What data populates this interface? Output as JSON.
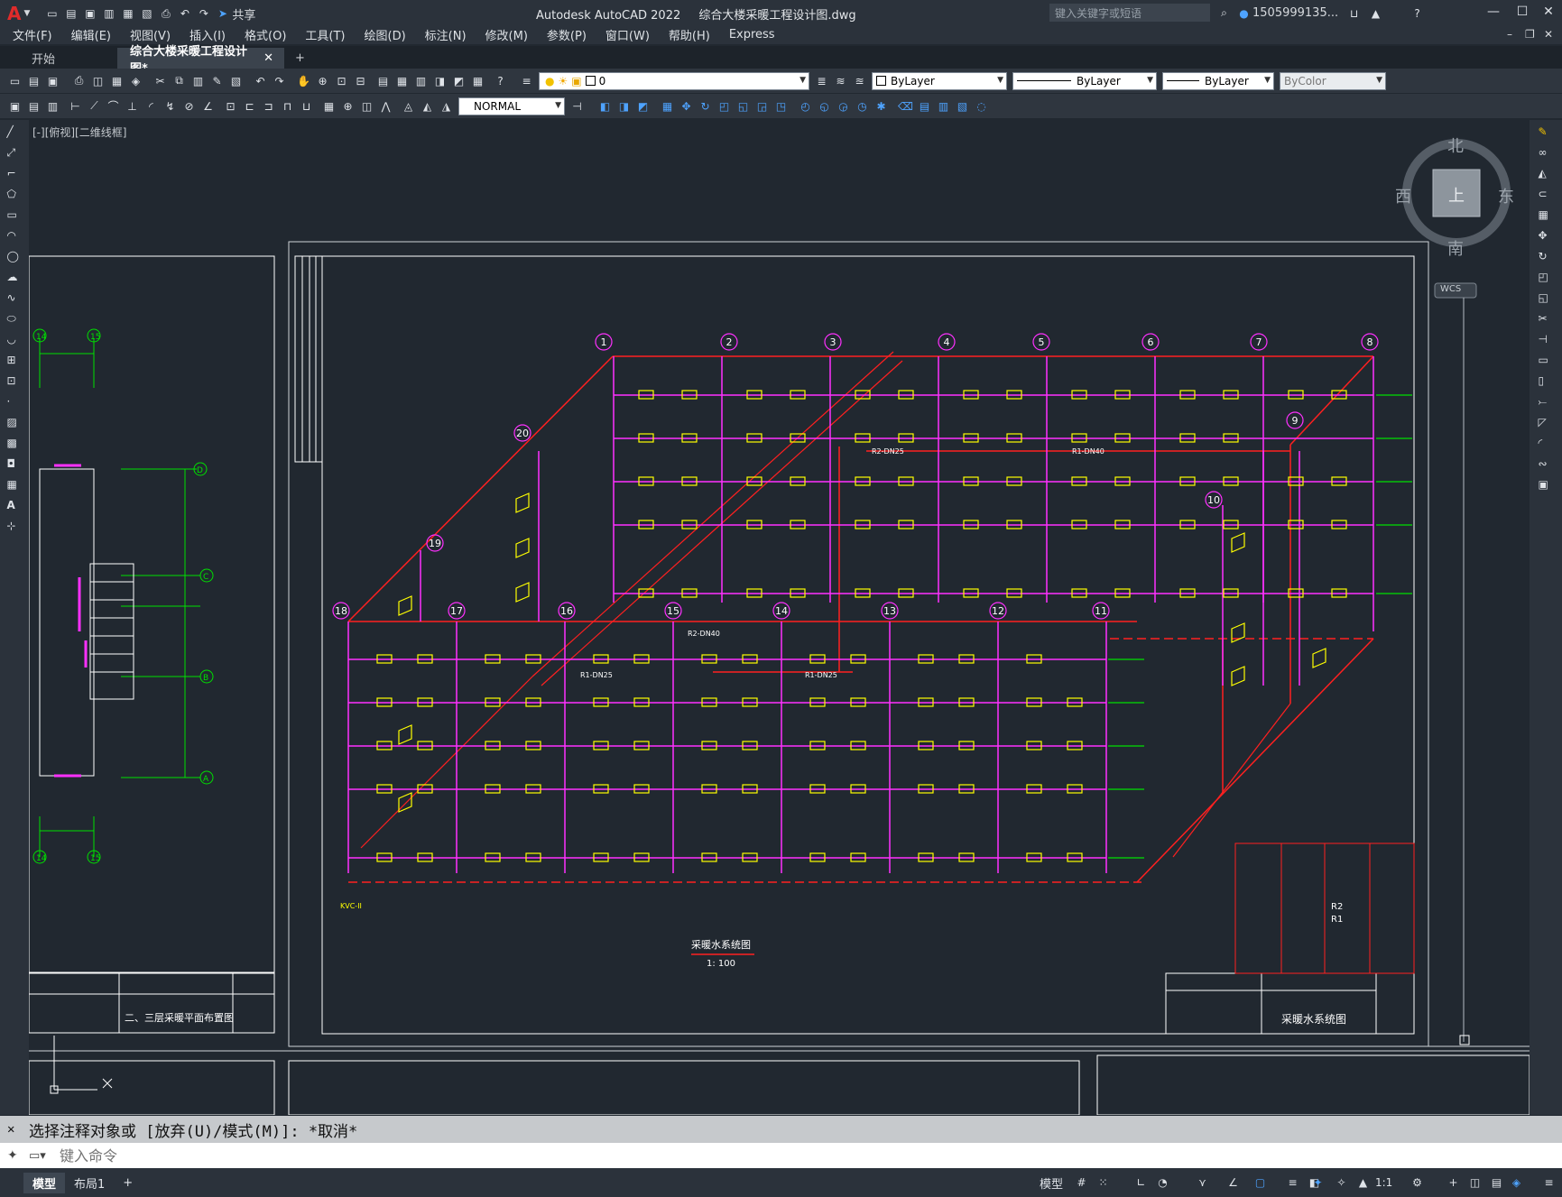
{
  "app": {
    "logo": "A",
    "title": "Autodesk AutoCAD 2022",
    "file": "综合大楼采暖工程设计图.dwg",
    "share": "共享",
    "search_placeholder": "键入关键字或短语",
    "user": "1505999135..."
  },
  "menu": [
    "文件(F)",
    "编辑(E)",
    "视图(V)",
    "插入(I)",
    "格式(O)",
    "工具(T)",
    "绘图(D)",
    "标注(N)",
    "修改(M)",
    "参数(P)",
    "窗口(W)",
    "帮助(H)",
    "Express"
  ],
  "tabs": {
    "start": "开始",
    "drawing": "综合大楼采暖工程设计图*",
    "add": "+"
  },
  "layer_combo": "0",
  "props": {
    "color": "ByLayer",
    "linetype": "ByLayer",
    "lineweight": "ByLayer",
    "plotstyle": "ByColor"
  },
  "dimstyle": "NORMAL",
  "viewport_label": "[-][俯视][二维线框]",
  "viewcube": {
    "north": "北",
    "south": "南",
    "east": "东",
    "west": "西",
    "top": "上",
    "wcs": "WCS"
  },
  "drawing": {
    "main_title": "采暖水系统图",
    "scale": "1: 100",
    "sheet_title": "采暖水系统图",
    "left_sheet_title": "二、三层采暖平面布置图",
    "axis_top": [
      "1",
      "2",
      "3",
      "4",
      "5",
      "6",
      "7",
      "8"
    ],
    "axis_mid": [
      "18",
      "17",
      "16",
      "15",
      "14",
      "13",
      "12",
      "11"
    ],
    "axis_right": [
      "9",
      "10"
    ],
    "axis_left": [
      "20",
      "19"
    ],
    "left_axes_top": [
      "14",
      "15"
    ],
    "left_axes_bottom": [
      "14",
      "15"
    ],
    "left_axes_side": [
      "D",
      "C",
      "B",
      "A"
    ],
    "legend_symbols": [
      "R2",
      "R1"
    ],
    "pipe_labels": [
      "R2-DN25",
      "R1-DN25",
      "R1-DN40",
      "R2-DN40",
      "R1-DN25",
      "KVC-II"
    ]
  },
  "command": {
    "history": "选择注释对象或 [放弃(U)/模式(M)]: *取消*",
    "placeholder": "键入命令"
  },
  "status": {
    "model_tab": "模型",
    "layout_tab": "布局1",
    "model_button": "模型",
    "scale": "1:1"
  }
}
